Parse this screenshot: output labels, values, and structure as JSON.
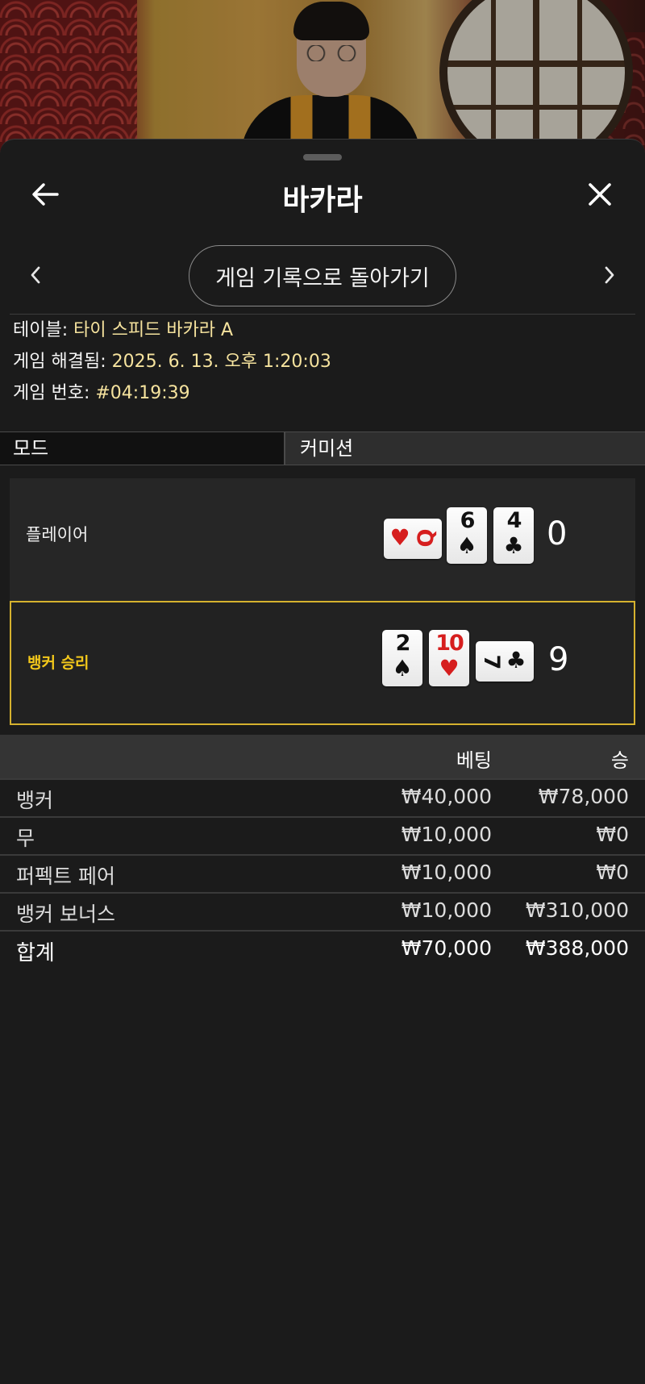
{
  "header": {
    "title": "바카라"
  },
  "nav": {
    "back_to_history": "게임 기록으로 돌아가기"
  },
  "info": {
    "table_label": "테이블: ",
    "table_value": "타이 스피드 바카라 A",
    "resolved_label": "게임 해결됨: ",
    "resolved_value": "2025. 6. 13. 오후 1:20:03",
    "game_number_label": "게임 번호: ",
    "game_number_value": "#04:19:39"
  },
  "mode": {
    "mode_label": "모드",
    "commission_label": "커미션"
  },
  "hands": {
    "player": {
      "label": "플레이어",
      "score": "0",
      "cards": [
        {
          "rank": "Q",
          "suit": "♥",
          "color": "red",
          "orientation": "sideways"
        },
        {
          "rank": "6",
          "suit": "♠",
          "color": "black",
          "orientation": "upright"
        },
        {
          "rank": "4",
          "suit": "♣",
          "color": "black",
          "orientation": "upright"
        }
      ]
    },
    "banker": {
      "label": "뱅커 승리",
      "score": "9",
      "cards": [
        {
          "rank": "2",
          "suit": "♠",
          "color": "black",
          "orientation": "upright"
        },
        {
          "rank": "10",
          "suit": "♥",
          "color": "red",
          "orientation": "upright"
        },
        {
          "rank": "7",
          "suit": "♣",
          "color": "black",
          "orientation": "sideways"
        }
      ]
    }
  },
  "bets": {
    "header_bet": "베팅",
    "header_win": "승",
    "rows": [
      {
        "name": "뱅커",
        "bet": "₩40,000",
        "win": "₩78,000"
      },
      {
        "name": "무",
        "bet": "₩10,000",
        "win": "₩0"
      },
      {
        "name": "퍼펙트 페어",
        "bet": "₩10,000",
        "win": "₩0"
      },
      {
        "name": "뱅커 보너스",
        "bet": "₩10,000",
        "win": "₩310,000"
      }
    ],
    "total": {
      "name": "합계",
      "bet": "₩70,000",
      "win": "₩388,000"
    }
  },
  "colors": {
    "accent_yellow": "#f3c81b",
    "info_value": "#f6e39e",
    "background": "#1b1b1b"
  },
  "icons": [
    "back-arrow-icon",
    "close-icon",
    "chevron-left-icon",
    "chevron-right-icon"
  ]
}
